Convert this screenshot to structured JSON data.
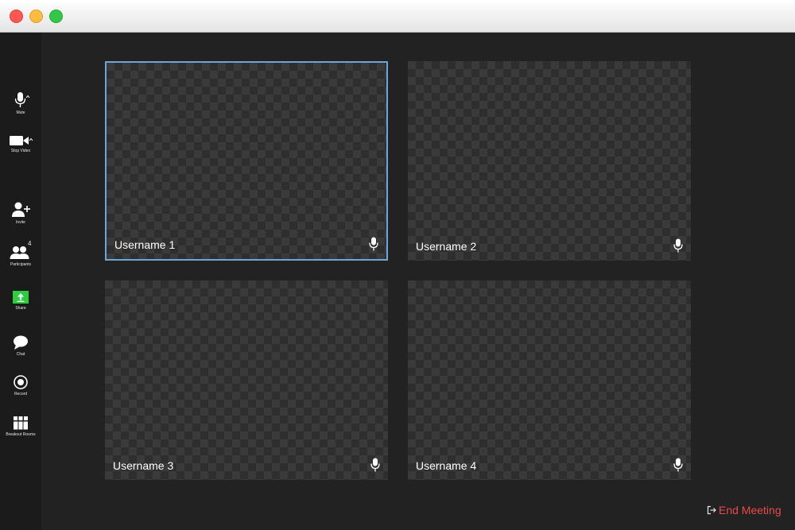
{
  "window": {
    "controls": [
      "close",
      "minimize",
      "maximize"
    ]
  },
  "sidebar": {
    "items": [
      {
        "label": "Mute",
        "icon": "microphone-icon"
      },
      {
        "label": "Stop Video",
        "icon": "video-camera-icon"
      },
      {
        "label": "Invite",
        "icon": "add-user-icon"
      },
      {
        "label": "Participants",
        "icon": "participants-icon",
        "badge": "4"
      },
      {
        "label": "Share",
        "icon": "share-screen-icon"
      },
      {
        "label": "Chat",
        "icon": "chat-icon"
      },
      {
        "label": "Record",
        "icon": "record-icon"
      },
      {
        "label": "Breakout Rooms",
        "icon": "breakout-rooms-icon"
      }
    ]
  },
  "tiles": [
    {
      "name": "Username 1",
      "active": true
    },
    {
      "name": "Username 2",
      "active": false
    },
    {
      "name": "Username 3",
      "active": false
    },
    {
      "name": "Username 4",
      "active": false
    }
  ],
  "top_right_icons": [
    "info-icon",
    "shield-check-icon",
    "gear-icon"
  ],
  "end_meeting": {
    "label": "End Meeting",
    "color": "#e8494a"
  },
  "colors": {
    "active_border": "#6aa7d8",
    "share_green": "#2ecc40",
    "background": "#222222"
  }
}
